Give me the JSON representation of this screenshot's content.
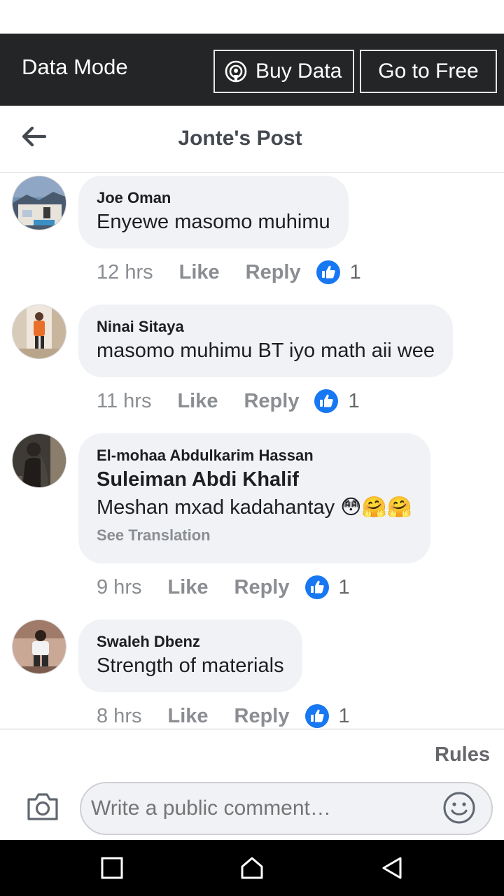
{
  "data_bar": {
    "mode_label": "Data Mode",
    "buy_data_label": "Buy Data",
    "go_free_label": "Go to Free"
  },
  "header": {
    "title": "Jonte's Post"
  },
  "comments": [
    {
      "author": "Joe Oman",
      "text": "Enyewe masomo muhimu",
      "time": "12 hrs",
      "like_label": "Like",
      "reply_label": "Reply",
      "reaction_count": "1",
      "reaction_icon": "thumbs-up-icon"
    },
    {
      "author": "Ninai Sitaya",
      "text": "masomo muhimu BT iyo math aii wee",
      "time": "11 hrs",
      "like_label": "Like",
      "reply_label": "Reply",
      "reaction_count": "1",
      "reaction_icon": "thumbs-up-icon"
    },
    {
      "author": "El-mohaa Abdulkarim Hassan",
      "mention": "Suleiman Abdi Khalif",
      "text": "Meshan mxad kadahantay 😳🤗🤗",
      "see_translation": "See Translation",
      "time": "9 hrs",
      "like_label": "Like",
      "reply_label": "Reply",
      "reaction_count": "1",
      "reaction_icon": "thumbs-up-icon"
    },
    {
      "author": "Swaleh Dbenz",
      "text": "Strength of materials",
      "time": "8 hrs",
      "like_label": "Like",
      "reply_label": "Reply",
      "reaction_count": "1",
      "reaction_icon": "thumbs-up-icon"
    }
  ],
  "composer": {
    "rules_label": "Rules",
    "placeholder": "Write a public comment…"
  },
  "colors": {
    "data_bar_bg": "#242526",
    "bubble_bg": "#f0f2f5",
    "like_blue": "#1877f2",
    "muted_text": "#8a8d91"
  }
}
